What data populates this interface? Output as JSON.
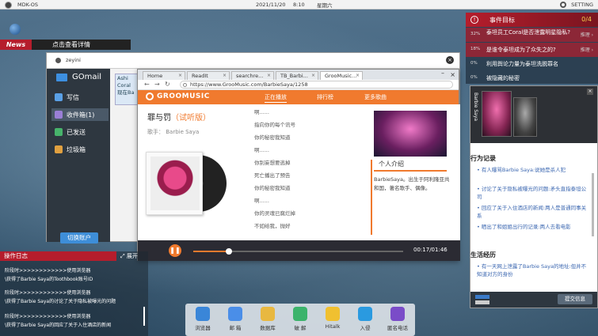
{
  "topbar": {
    "os_name": "MDK-OS",
    "date": "2021/11/20",
    "time": "8:10",
    "weekday": "星期六",
    "settings_label": "SETTING"
  },
  "news": {
    "label": "News",
    "link": "点击查看详情"
  },
  "mail": {
    "user": "zeyini",
    "brand": "GOmail",
    "nav": [
      {
        "label": "写信",
        "color": "#5aa0e6"
      },
      {
        "label": "收件箱(1)",
        "color": "#9a7fd6"
      },
      {
        "label": "已发送",
        "color": "#47b36b"
      },
      {
        "label": "垃圾箱",
        "color": "#e0a040"
      }
    ],
    "switch_account": "切换账户",
    "preview_lines": [
      "Ashi",
      "Coral",
      "现在Ba"
    ]
  },
  "browser": {
    "tabs": [
      "Home",
      "ReadIt",
      "searchre...",
      "TB_Barbi...",
      "GrooMusic..."
    ],
    "url": "https://www.GrooMusic.com/BarbieSaya/1258",
    "site": {
      "logo": "GROOMUSIC",
      "nav": [
        "正在播放",
        "排行榜",
        "更多歌曲"
      ],
      "song_title": "罪与罚",
      "song_trial": "（试听版）",
      "singer": "歌手：   Barbie Saya",
      "lyrics": [
        "啊......",
        "指向你的每个讯号",
        "你的秘密我知道",
        "啊......",
        "你别妄想要逃掉",
        "死亡播出了预告",
        "你的秘密我知道",
        "啊......",
        "你的灵魂已腐烂掉",
        "不如给我，抛好"
      ],
      "intro_title": "个人介绍",
      "intro_text": "BarbieSaya。出生于阿利隆亚共和国，著名歌手、偶像。"
    },
    "player": {
      "current": "00:17",
      "total": "01:46",
      "progress": 0.17
    }
  },
  "log": {
    "title": "操作日志",
    "expand": "展开",
    "entries": [
      "阶段时>>>>>>>>>>>>使用浏览器",
      "\\获得了Barbie Saya的Toothbook账号ID",
      "阶段时>>>>>>>>>>>>使用浏览器",
      "\\获得了Barbie Saya的讨论了关于隐私被曝光的问题",
      "阶段时>>>>>>>>>>>>使用浏览器",
      "\\获得了Barbie Saya的回应了关于入住酒店的新闻"
    ]
  },
  "dock": [
    {
      "label": "浏览器",
      "color": "#3a86d8"
    },
    {
      "label": "邮 箱",
      "color": "#4a8ee8"
    },
    {
      "label": "数据库",
      "color": "#e8b840"
    },
    {
      "label": "破 解",
      "color": "#3bb36b"
    },
    {
      "label": "Hitalk",
      "color": "#f0c030"
    },
    {
      "label": "入侵",
      "color": "#2a9ae0"
    },
    {
      "label": "匿名电话",
      "color": "#7a4cc8"
    }
  ],
  "objectives": {
    "title": "事件目标",
    "count": "0/4",
    "items": [
      {
        "pct": "32%",
        "text": "泰坦员工Coral是否泄露明星隐私?",
        "push": "推理 ›",
        "highlight": true
      },
      {
        "pct": "18%",
        "text": "是谁令泰坦成为了众失之的?",
        "push": "推理 ›",
        "highlight": true
      },
      {
        "pct": "0%",
        "text": "利用舆论力量为泰坦洗脱罪名",
        "push": "",
        "highlight": false
      },
      {
        "pct": "0%",
        "text": "被隐藏的秘密",
        "push": "",
        "highlight": false
      }
    ]
  },
  "character": {
    "tab_label": "Barbie Saya",
    "behavior_title": "行为记录",
    "records": [
      "有人曝骂Barbie Saya:说她是杀人犯",
      "讨论了关于隐私被曝光的问题:矛头直指泰坦公司",
      "回应了关于入住酒店的新闻:两人是普通同事关系",
      "晒出了和姐姐出行的记录:两人去看电影"
    ],
    "life_title": "生活经历",
    "life_records": [
      "有一天网上泄露了Barbie Saya的地址:但并不知道对方的身份"
    ],
    "submit": "提交信息"
  }
}
